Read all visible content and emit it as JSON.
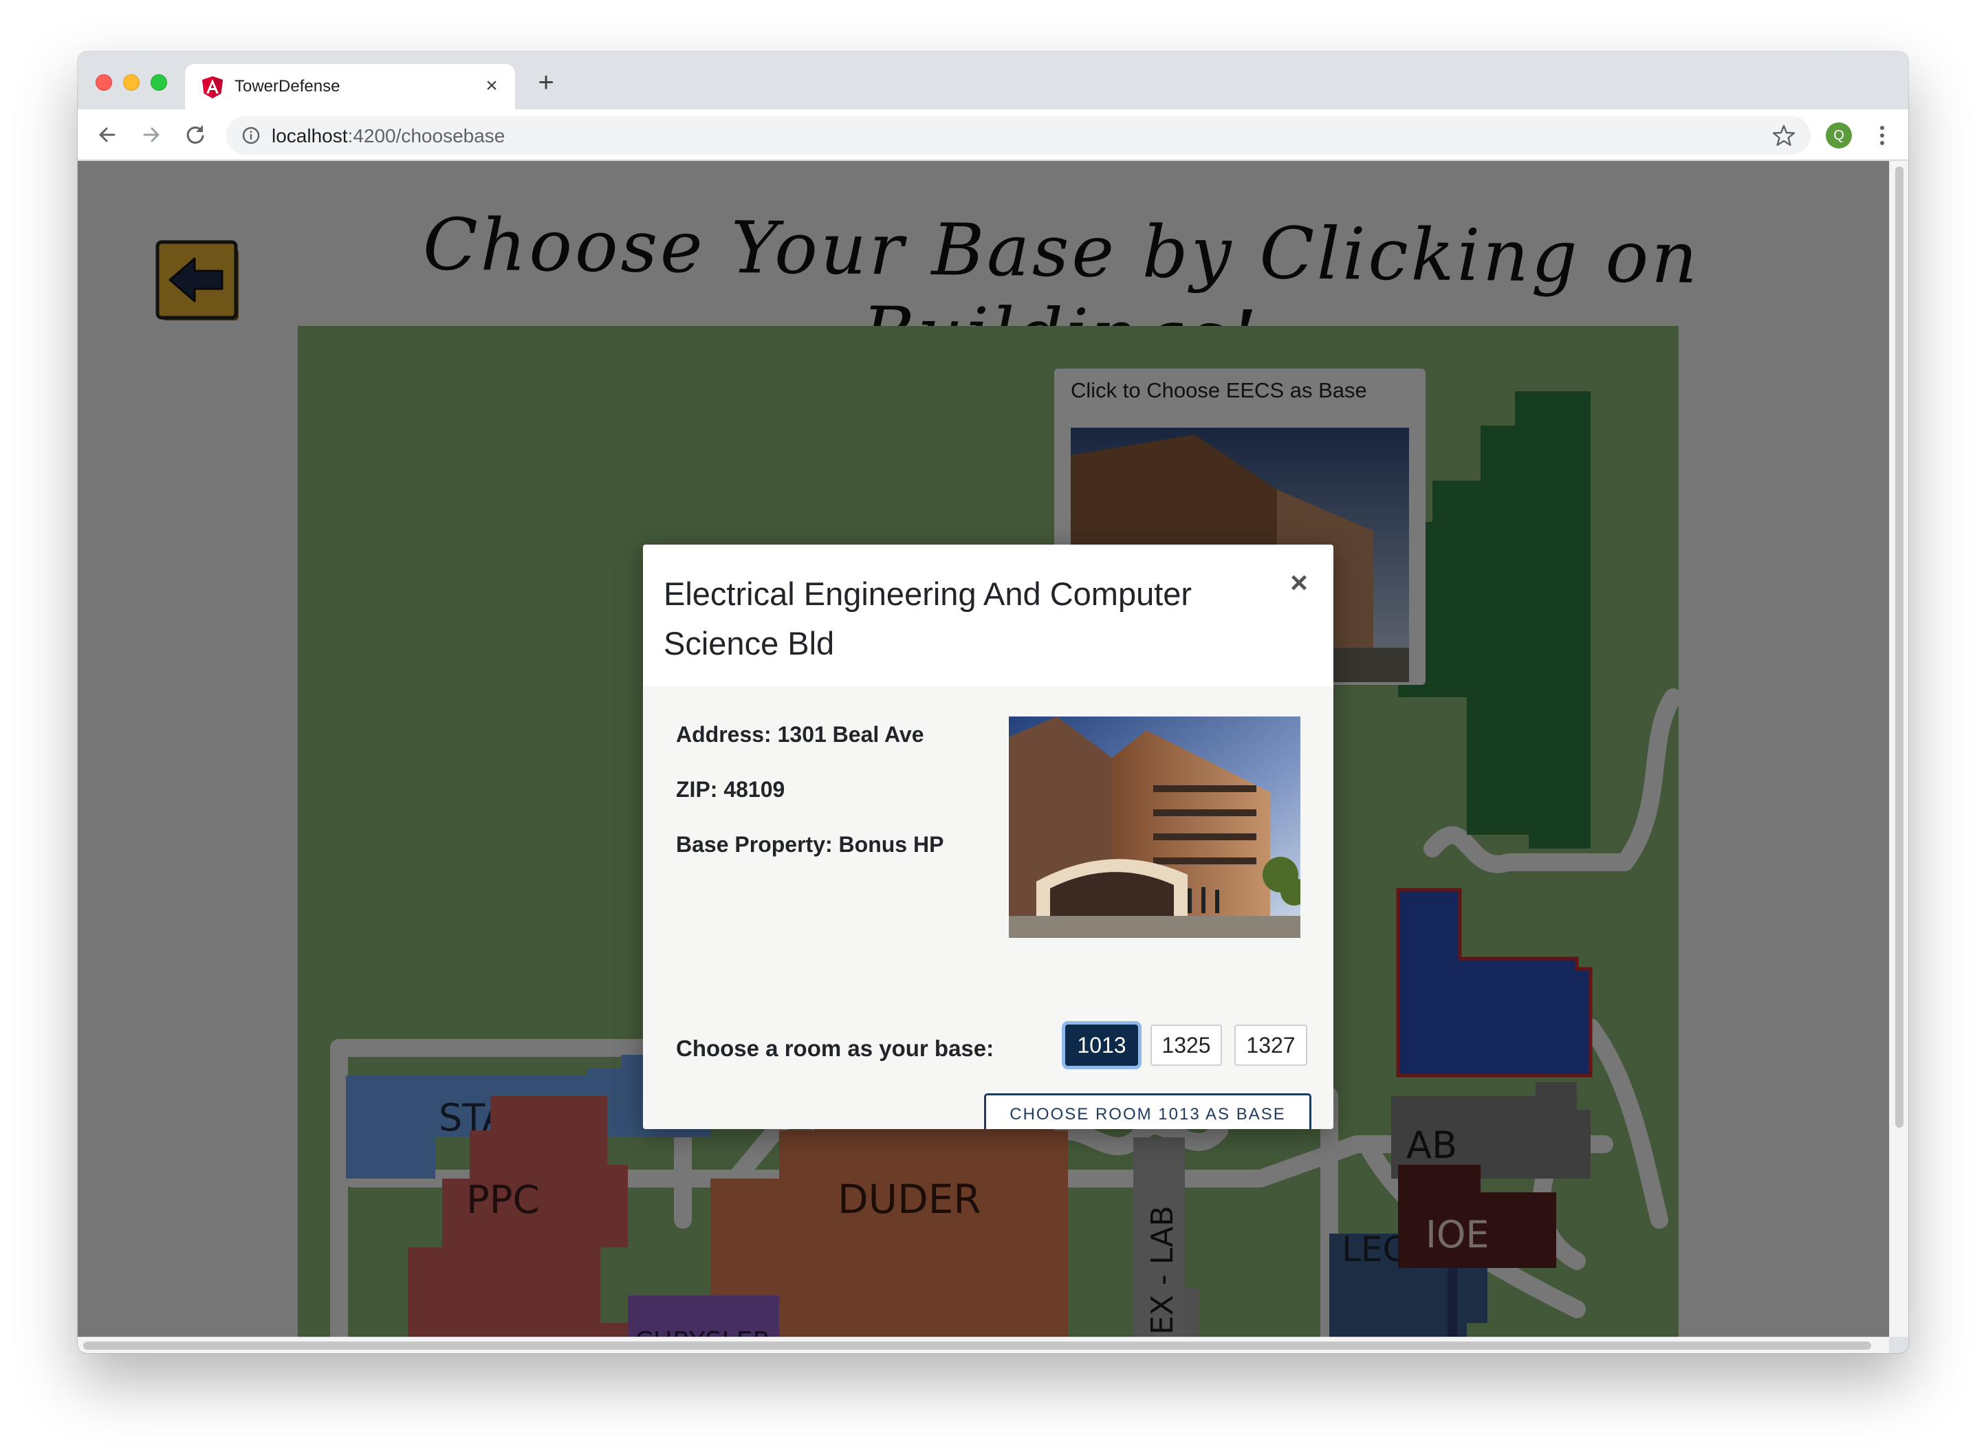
{
  "browser": {
    "tab_title": "TowerDefense",
    "url_host": "localhost",
    "url_path": ":4200/choosebase",
    "profile_initial": "Q"
  },
  "page": {
    "title": "Choose Your Base by Clicking on Buildings!",
    "eecs_card_label": "Click to Choose EECS as Base",
    "map_labels": {
      "stamps": "STAMPS",
      "ppc": "PPC",
      "duder": "DUDER",
      "chrysler": "CHRYSLER",
      "lab": "AB",
      "lec": "LEC",
      "ioe": "IOE",
      "annex_lab": "NEX - LAB"
    },
    "building_colors": {
      "map_background": "#86b073",
      "stamps": "#6a9ee6",
      "ppc": "#c85f5a",
      "duder": "#d67a52",
      "chrysler": "#8d5fc0",
      "eecs": "#2a4fb5",
      "green_building": "#2e7b40",
      "lab": "#7c7c7c",
      "lec": "#3a5b86",
      "ioe": "#5a2121",
      "paths": "#efefef"
    }
  },
  "modal": {
    "title": "Electrical Engineering And Computer Science Bld",
    "address": "Address: 1301 Beal Ave",
    "zip": "ZIP: 48109",
    "property": "Base Property: Bonus HP",
    "room_prompt": "Choose a room as your base:",
    "rooms": [
      "1013",
      "1325",
      "1327"
    ],
    "selected_room": "1013",
    "choose_button": "CHOOSE ROOM 1013 AS BASE"
  }
}
